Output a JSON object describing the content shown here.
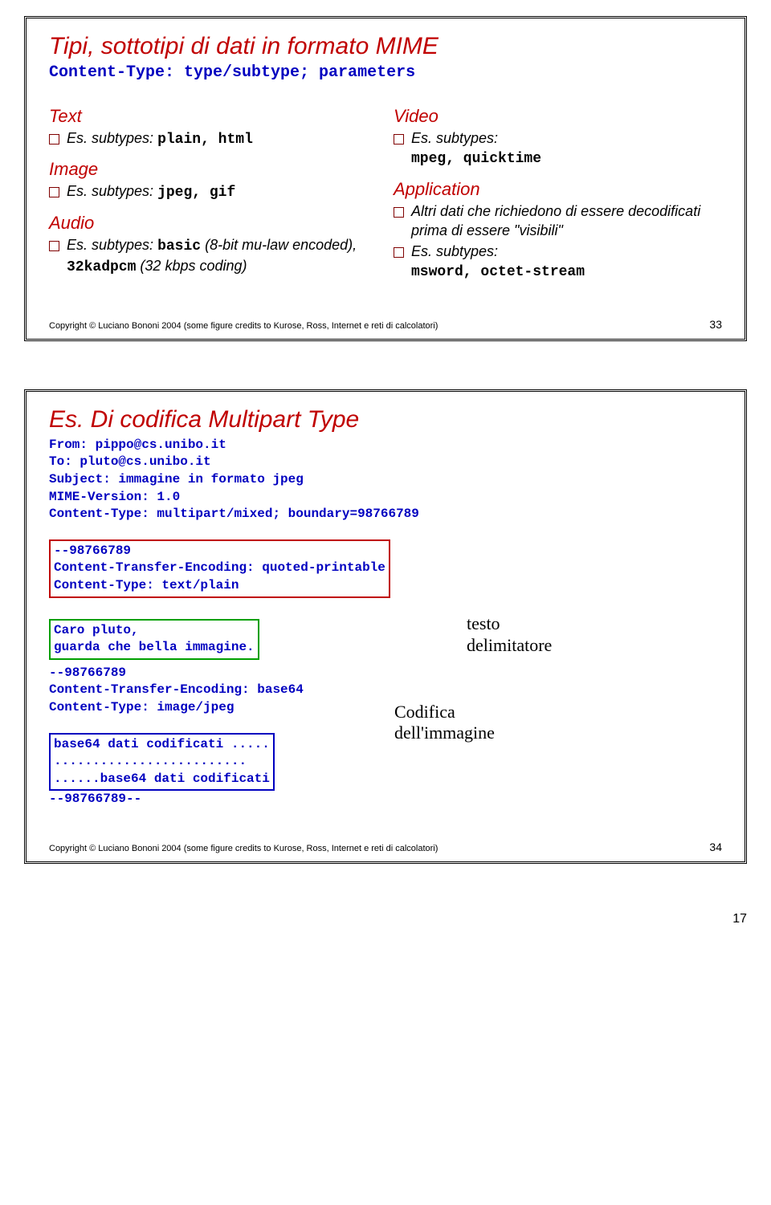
{
  "slide1": {
    "title": "Tipi, sottotipi di dati in formato MIME",
    "subtitle": "Content-Type: type/subtype; parameters",
    "left": {
      "text_head": "Text",
      "text_line_a": "Es. subtypes: ",
      "text_line_b": "plain, html",
      "image_head": "Image",
      "image_line_a": "Es. subtypes: ",
      "image_line_b": "jpeg, gif",
      "audio_head": "Audio",
      "audio_line_a": "Es. subtypes: ",
      "audio_line_b": "basic",
      "audio_line_c": " (8-bit mu-law encoded), ",
      "audio_line_d": "32kadpcm",
      "audio_line_e": " (32 kbps coding)"
    },
    "right": {
      "video_head": "Video",
      "video_line_a": "Es. subtypes:",
      "video_line_b": "mpeg, quicktime",
      "app_head": "Application",
      "app_line1": "Altri dati che richiedono di essere decodificati prima di essere \"visibili\"",
      "app_line2a": "Es. subtypes:",
      "app_line2b": "msword, octet-stream"
    },
    "copyright": "Copyright © Luciano Bononi 2004 (some figure credits to Kurose, Ross, Internet e reti di calcolatori)",
    "page": "33"
  },
  "slide2": {
    "title": "Es. Di codifica Multipart Type",
    "header_block": "From: pippo@cs.unibo.it\nTo: pluto@cs.unibo.it\nSubject: immagine in formato jpeg\nMIME-Version: 1.0\nContent-Type: multipart/mixed; boundary=98766789",
    "box_red": "--98766789\nContent-Transfer-Encoding: quoted-printable\nContent-Type: text/plain",
    "box_green": "Caro pluto,\nguarda che bella immagine.",
    "mid_block": "--98766789\nContent-Transfer-Encoding: base64\nContent-Type: image/jpeg",
    "box_blue": "base64 dati codificati .....\n.........................\n......base64 dati codificati",
    "tail": "--98766789--",
    "annot_testo": "testo",
    "annot_delim": "delimitatore",
    "annot_codifica": "Codifica\ndell'immagine",
    "copyright": "Copyright © Luciano Bononi 2004 (some figure credits to Kurose, Ross, Internet e reti di calcolatori)",
    "page": "34"
  },
  "footer_page": "17"
}
